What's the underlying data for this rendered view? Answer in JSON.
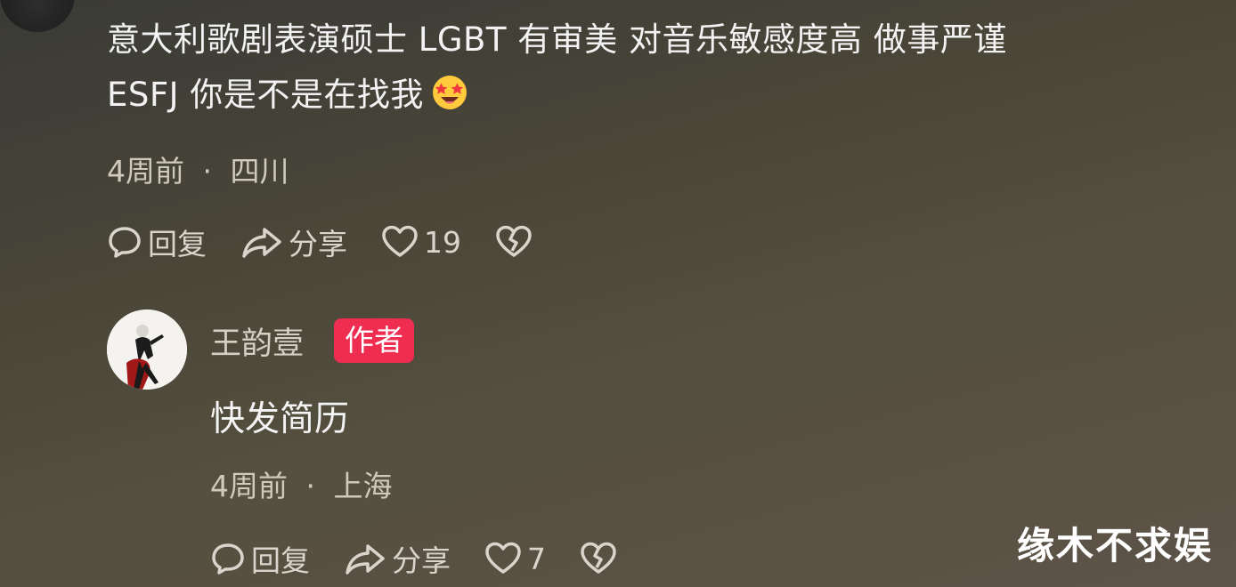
{
  "comment": {
    "text_line1": "意大利歌剧表演硕士 LGBT 有审美 对音乐敏感度高 做事严谨",
    "text_line2": "ESFJ 你是不是在找我",
    "emoji": "star-struck-emoji",
    "time": "4周前",
    "location": "四川",
    "reply_label": "回复",
    "share_label": "分享",
    "likes": "19"
  },
  "reply": {
    "username": "王韵壹",
    "badge": "作者",
    "text": "快发简历",
    "time": "4周前",
    "location": "上海",
    "reply_label": "回复",
    "share_label": "分享",
    "likes": "7"
  },
  "separator": "·",
  "watermark": "缘木不求娱",
  "colors": {
    "badge": "#ee2d51",
    "text": "#f4f4f4",
    "meta": "#cfcabd"
  }
}
